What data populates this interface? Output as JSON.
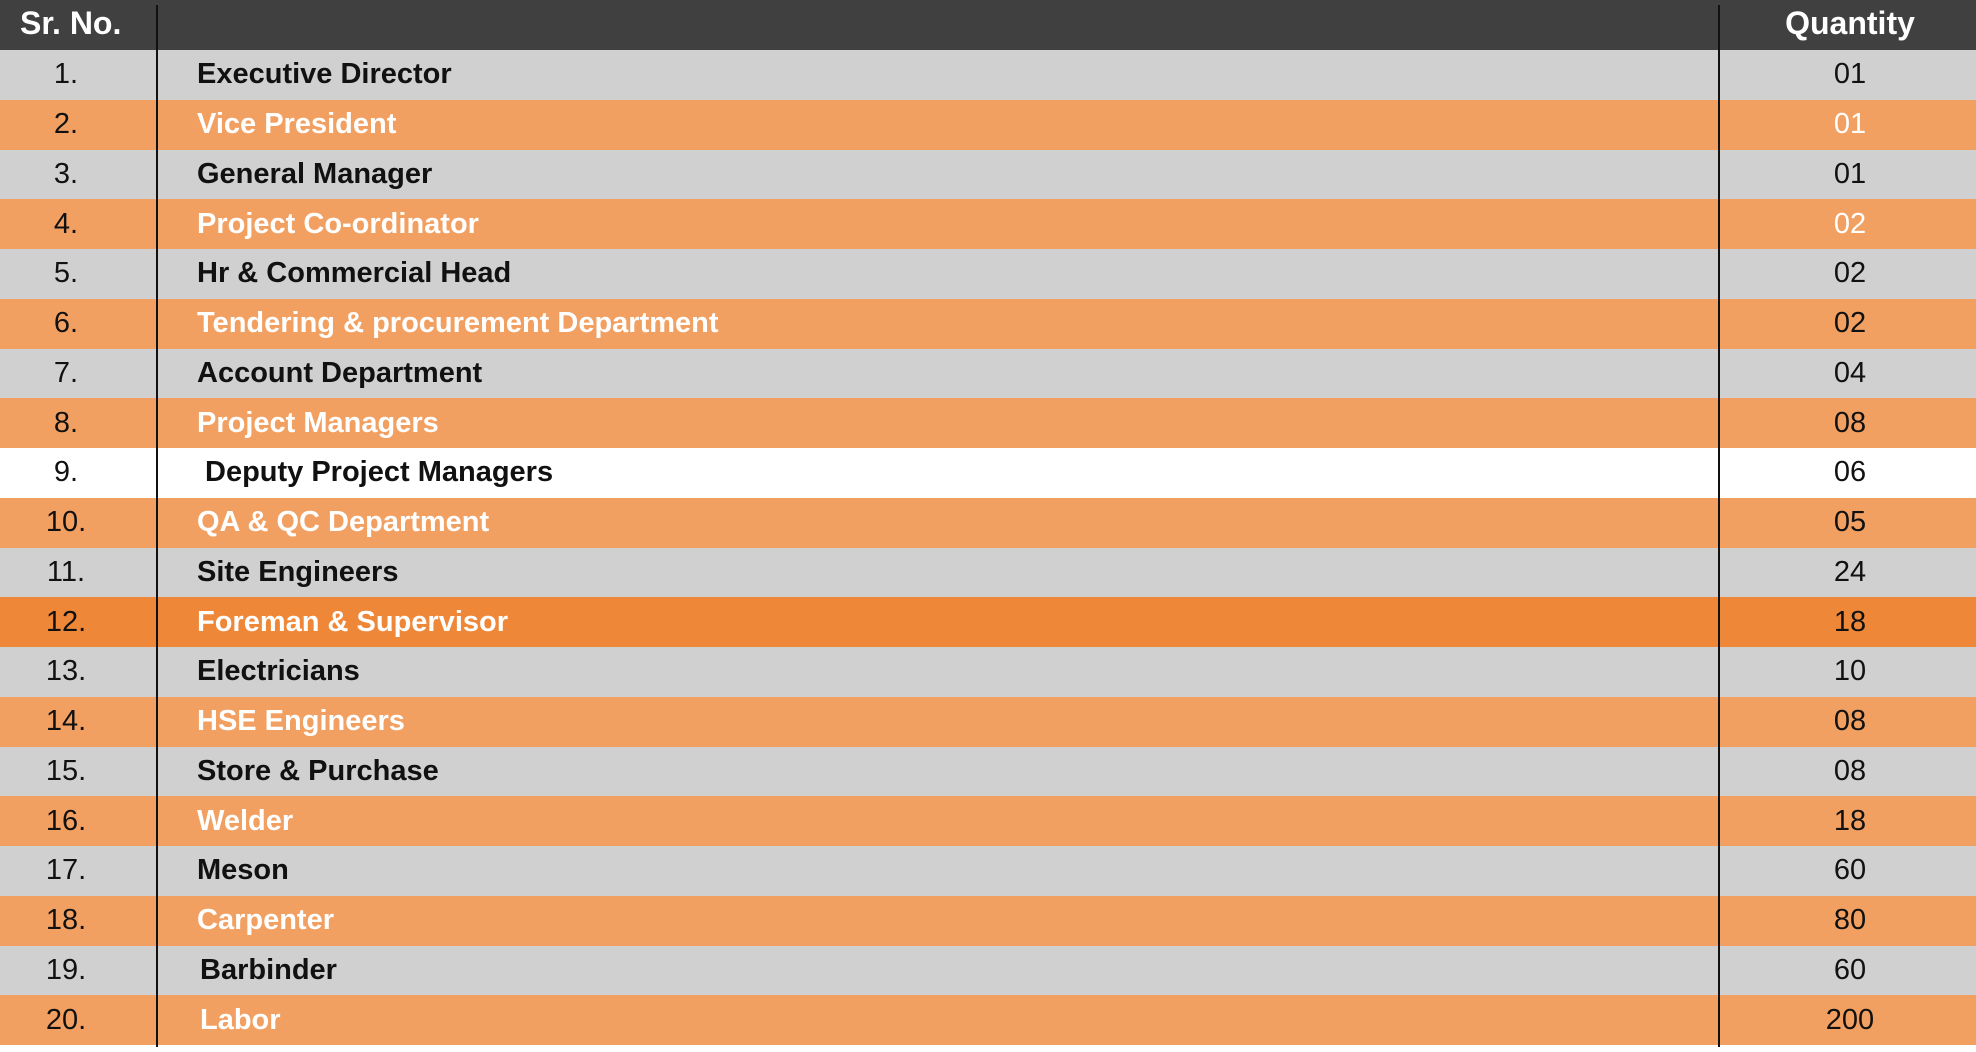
{
  "header": {
    "sr_no": "Sr. No.",
    "name": "",
    "quantity": "Quantity"
  },
  "rows": [
    {
      "no": "1.",
      "name": "Executive Director",
      "qty": "01"
    },
    {
      "no": "2.",
      "name": "Vice President",
      "qty": "01"
    },
    {
      "no": "3.",
      "name": "General Manager",
      "qty": "01"
    },
    {
      "no": "4.",
      "name": "Project Co-ordinator",
      "qty": "02"
    },
    {
      "no": "5.",
      "name": "Hr & Commercial Head",
      "qty": "02"
    },
    {
      "no": "6.",
      "name": "Tendering & procurement Department",
      "qty": "02"
    },
    {
      "no": "7.",
      "name": "Account Department",
      "qty": "04"
    },
    {
      "no": "8.",
      "name": "Project Managers",
      "qty": "08"
    },
    {
      "no": "9.",
      "name": "Deputy Project Managers",
      "qty": "06"
    },
    {
      "no": "10.",
      "name": "QA & QC Department",
      "qty": "05"
    },
    {
      "no": "11.",
      "name": "Site Engineers",
      "qty": "24"
    },
    {
      "no": "12.",
      "name": "Foreman & Supervisor",
      "qty": "18"
    },
    {
      "no": "13.",
      "name": "Electricians",
      "qty": "10"
    },
    {
      "no": "14.",
      "name": "HSE Engineers",
      "qty": "08"
    },
    {
      "no": "15.",
      "name": "Store & Purchase",
      "qty": "08"
    },
    {
      "no": "16.",
      "name": "Welder",
      "qty": "18"
    },
    {
      "no": "17.",
      "name": "Meson",
      "qty": "60"
    },
    {
      "no": "18.",
      "name": "Carpenter",
      "qty": "80"
    },
    {
      "no": "19.",
      "name": "Barbinder",
      "qty": "60"
    },
    {
      "no": "20.",
      "name": "Labor",
      "qty": "200"
    }
  ],
  "colors": {
    "header_bg": "#404040",
    "row_grey": "#d0d0d0",
    "row_orange": "#f2a062",
    "row_orange_dark": "#ef8738",
    "row_white": "#ffffff"
  }
}
